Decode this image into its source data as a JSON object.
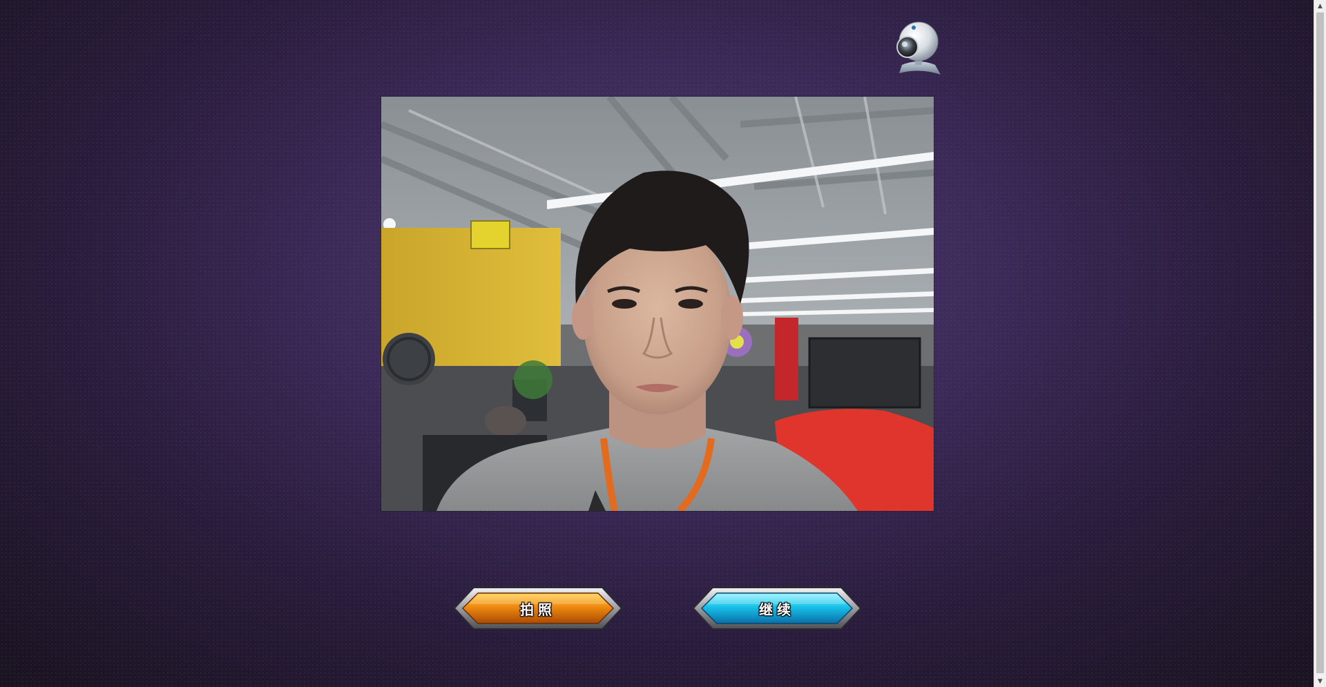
{
  "buttons": {
    "photo_label": "拍照",
    "continue_label": "继续"
  },
  "icons": {
    "webcam": "webcam-icon",
    "scroll_up": "arrow-up-icon",
    "scroll_down": "arrow-down-icon"
  },
  "colors": {
    "background": "#3c2a58",
    "photo_button": "#e87a0c",
    "continue_button": "#1ec4e8"
  }
}
